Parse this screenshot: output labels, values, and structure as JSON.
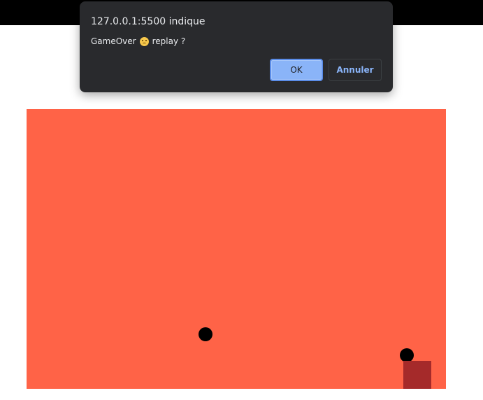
{
  "top_bar": {
    "color": "#000000"
  },
  "game": {
    "background": "#ff6347",
    "ball_color": "#000000",
    "paddle_color": "#a52a2a"
  },
  "dialog": {
    "title": "127.0.0.1:5500 indique",
    "message_prefix": "GameOver",
    "emoji_icon": "sad-face-icon",
    "message_suffix": "replay ?",
    "ok_label": "OK",
    "cancel_label": "Annuler",
    "background": "#292a2d",
    "ok_color": "#8ab4f8"
  }
}
